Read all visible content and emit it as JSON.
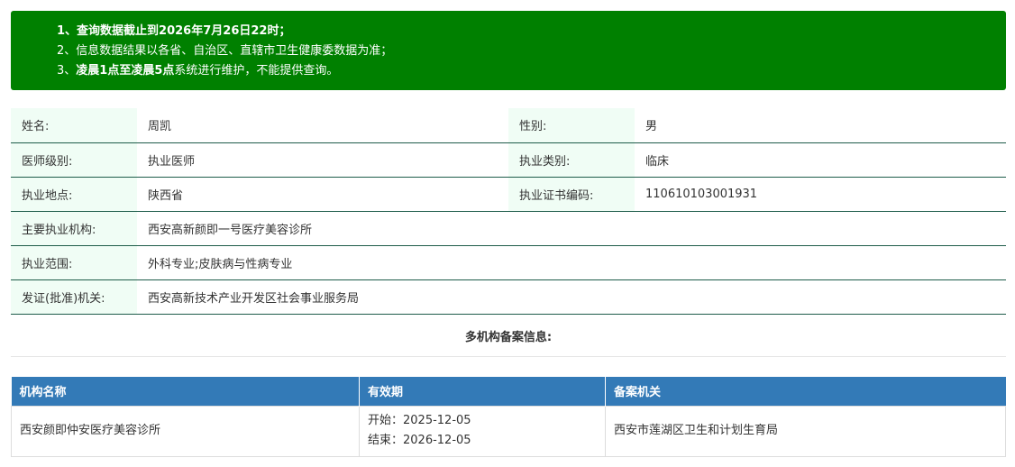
{
  "notice": {
    "line1": "1、查询数据截止到2026年7月26日22时；",
    "line2": "2、信息数据结果以各省、自治区、直辖市卫生健康委数据为准；",
    "line3_prefix": "3、",
    "line3_bold": "凌晨1点至凌晨5点",
    "line3_rest": "系统进行维护，不能提供查询。"
  },
  "info": {
    "name_label": "姓名:",
    "name": "周凯",
    "gender_label": "性别:",
    "gender": "男",
    "level_label": "医师级别:",
    "level": "执业医师",
    "category_label": "执业类别:",
    "category": "临床",
    "location_label": "执业地点:",
    "location": "陕西省",
    "cert_label": "执业证书编码:",
    "cert": "110610103001931",
    "institution_label": "主要执业机构:",
    "institution": "西安高新颜即一号医疗美容诊所",
    "scope_label": "执业范围:",
    "scope": "外科专业;皮肤病与性病专业",
    "issuer_label": "发证(批准)机关:",
    "issuer": "西安高新技术产业开发区社会事业服务局"
  },
  "multi": {
    "title": "多机构备案信息:",
    "headers": [
      "机构名称",
      "有效期",
      "备案机关"
    ],
    "rows": [
      {
        "name": "西安颜即仲安医疗美容诊所",
        "start": "开始：2025-12-05",
        "end": "结束：2026-12-05",
        "authority": "西安市莲湖区卫生和计划生育局"
      }
    ]
  }
}
